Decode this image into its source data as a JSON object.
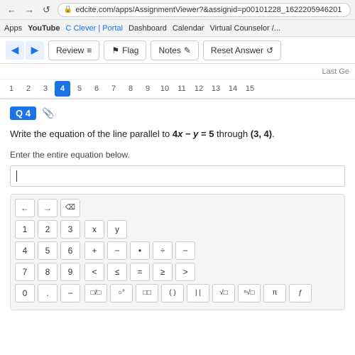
{
  "browser": {
    "back_label": "←",
    "forward_label": "→",
    "reload_label": "↺",
    "url": "edcite.com/apps/AssignmentViewer?&assignid=p00101228_1622205946201"
  },
  "apps_bar": {
    "apps_label": "Apps",
    "youtube_label": "YouTube",
    "clever_label": "C Clever | Portal",
    "dashboard_label": "Dashboard",
    "calendar_label": "Calendar",
    "counselor_label": "Virtual Counselor /..."
  },
  "toolbar": {
    "back_label": "◀",
    "forward_label": "▶",
    "review_label": "Review",
    "flag_label": "Flag",
    "notes_label": "Notes",
    "reset_label": "Reset Answer"
  },
  "last_ge": {
    "label": "Last Ge"
  },
  "question_tabs": {
    "tabs": [
      "1",
      "2",
      "3",
      "4",
      "5",
      "6",
      "7",
      "8",
      "9",
      "10",
      "11",
      "12",
      "13",
      "14",
      "15"
    ],
    "active": "4"
  },
  "question": {
    "label": "Q 4",
    "text": "Write the equation of the line parallel to 4x − y = 5 through (3, 4).",
    "instruction": "Enter the entire equation below.",
    "input_cursor": "|"
  },
  "keyboard": {
    "nav_back": "←",
    "nav_forward": "→",
    "nav_delete": "⌫",
    "num_row1": [
      "1",
      "2",
      "3"
    ],
    "num_row2": [
      "4",
      "5",
      "6"
    ],
    "num_row3": [
      "7",
      "8",
      "9"
    ],
    "num_row4": [
      "0",
      ".",
      "-"
    ],
    "var_row": [
      "x",
      "y"
    ],
    "ops_row": [
      "+",
      "−",
      "•",
      "÷",
      "−"
    ],
    "rel_row": [
      "<",
      "≤",
      "=",
      "≥",
      ">"
    ],
    "special_row1": [
      "□/□",
      "○°",
      "□□",
      "( )",
      "||",
      "√□",
      "ⁿ√□",
      "π",
      "ƒ"
    ]
  }
}
